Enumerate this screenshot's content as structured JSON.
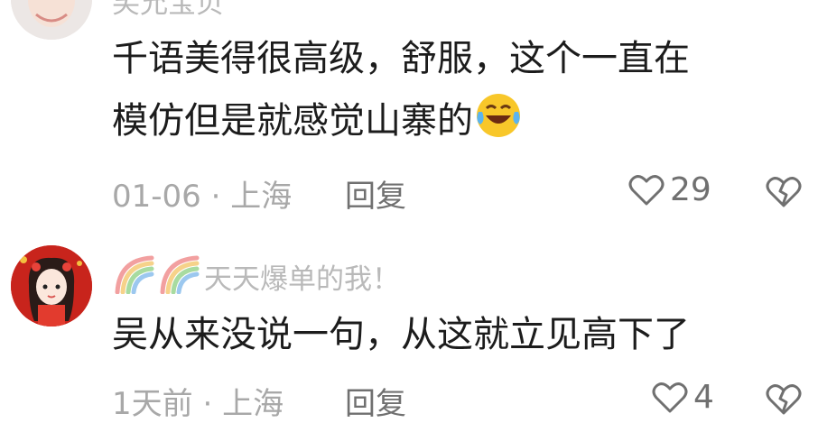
{
  "comments": [
    {
      "username": "笑允宝贝",
      "content_line1": "千语美得很高级，舒服，这个一直在",
      "content_line2": "模仿但是就感觉山寨的",
      "emoji": "laughing-crying-emoji",
      "date": "01-06",
      "separator": "·",
      "location": "上海",
      "reply_label": "回复",
      "like_count": "29"
    },
    {
      "username": "天天爆单的我！",
      "content_line1": "吴从来没说一句，从这就立见高下了",
      "date": "1天前",
      "separator": "·",
      "location": "上海",
      "reply_label": "回复",
      "like_count": "4"
    }
  ],
  "colors": {
    "text": "#1c1c1c",
    "meta": "#a8a8a8",
    "username": "#b9b9b9",
    "icon": "#707070"
  }
}
